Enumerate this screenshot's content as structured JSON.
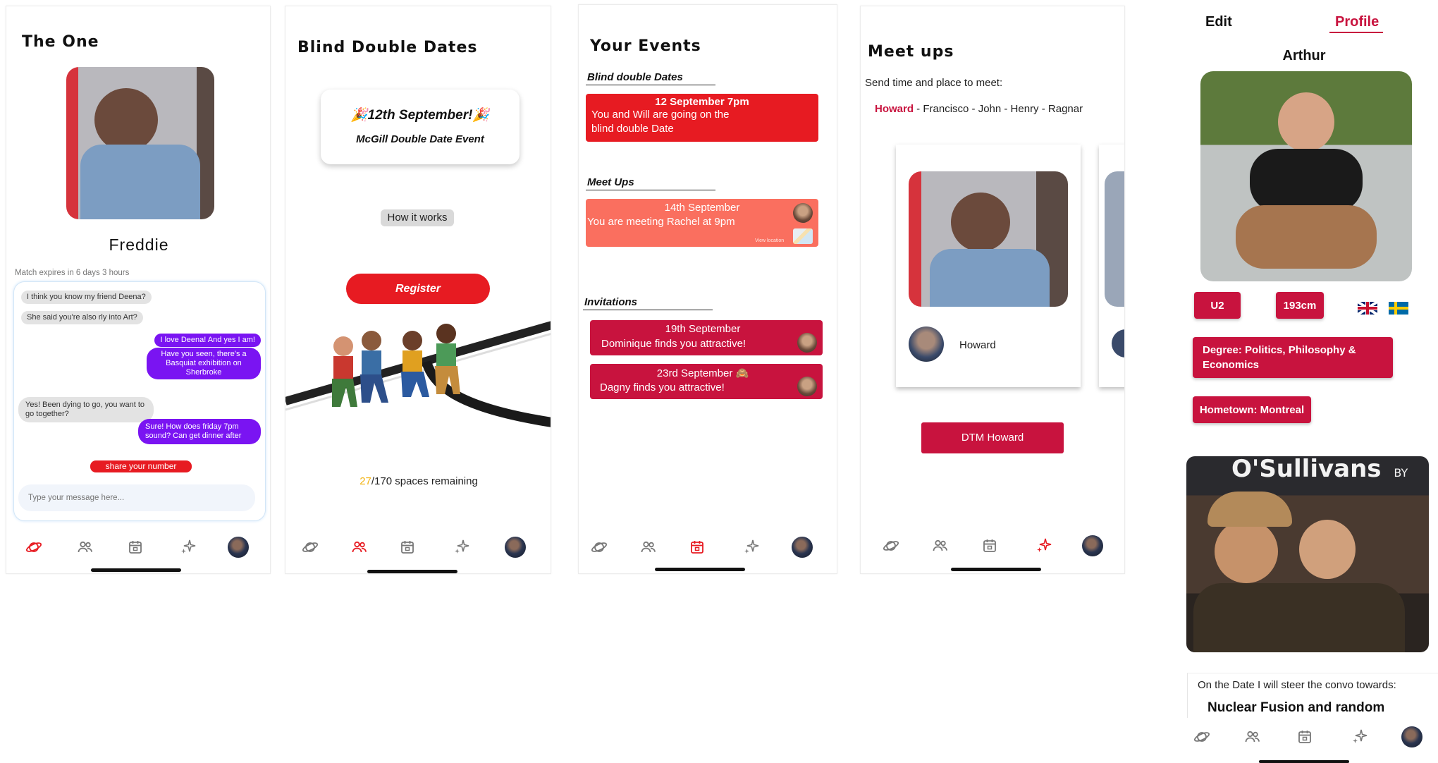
{
  "colors": {
    "accent_red": "#e71b22",
    "event_red": "#c8133e",
    "salmon": "#fa6f5f",
    "chat_purple": "#7a14f2",
    "gold": "#f2b20f",
    "profile_red": "#c8133e"
  },
  "nav": {
    "items": [
      {
        "name": "planet-icon"
      },
      {
        "name": "people-icon"
      },
      {
        "name": "calendar-icon"
      },
      {
        "name": "sparkle-icon"
      },
      {
        "name": "avatar"
      }
    ]
  },
  "screen1": {
    "title": "The One",
    "match_name": "Freddie",
    "expiry": "Match expires in 6 days 3 hours",
    "messages": [
      {
        "from": "in",
        "text": "I think you know my friend Deena?"
      },
      {
        "from": "in",
        "text": "She said you're also rly into Art?"
      },
      {
        "from": "out",
        "text": "I love Deena! And yes I am!"
      },
      {
        "from": "out",
        "text": "Have you seen, there's a Basquiat exhibition  on Sherbroke"
      },
      {
        "from": "in",
        "text": "Yes! Been dying to go, you want to go together?"
      },
      {
        "from": "out",
        "text": "Sure! How does friday 7pm sound? Can get dinner after"
      }
    ],
    "share_button": "share your number",
    "input_placeholder": "Type your message here..."
  },
  "screen2": {
    "title": "Blind Double Dates",
    "event_date": "🎉12th September!🎉",
    "event_name": "McGill Double Date Event",
    "how_it_works": "How it works",
    "register": "Register",
    "spaces_taken": "27",
    "spaces_rest": "/170 spaces remaining"
  },
  "screen3": {
    "title": "Your Events",
    "section_blind": "Blind double Dates",
    "blind_card": {
      "date": "12 September 7pm",
      "text": "You and Will are going on the blind double Date"
    },
    "section_meetups": "Meet Ups",
    "meetup_card": {
      "date": "14th September",
      "text": "You are meeting Rachel at 9pm",
      "view_location": "View location"
    },
    "section_invitations": "Invitations",
    "invitations": [
      {
        "date": "19th September",
        "text": "Dominique finds you attractive!"
      },
      {
        "date": "23rd September 🙈",
        "text": "Dagny finds you attractive!"
      }
    ]
  },
  "screen4": {
    "title": "Meet ups",
    "subtitle": "Send time and place to meet:",
    "names": {
      "selected": "Howard",
      "rest": " - Francisco - John - Henry - Ragnar"
    },
    "card_name": "Howard",
    "dtm_button": "DTM Howard"
  },
  "screen5": {
    "edit_tab": "Edit",
    "profile_tab": "Profile",
    "name": "Arthur",
    "tags": [
      "U2",
      "193cm"
    ],
    "flags": [
      "uk-flag",
      "sweden-flag"
    ],
    "degree": "Degree: Politics, Philosophy  & Economics",
    "hometown": "Hometown: Montreal",
    "sign_text": "O'Sullivans",
    "sign_subtext": "BY THE MILL",
    "prompt": "On the Date I will steer the convo towards:",
    "answer": "Nuclear Fusion and random"
  }
}
